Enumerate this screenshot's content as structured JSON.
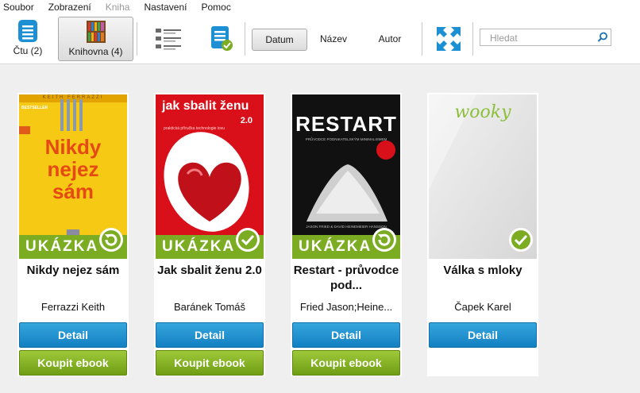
{
  "menu": [
    {
      "label": "Soubor",
      "enabled": true
    },
    {
      "label": "Zobrazení",
      "enabled": true
    },
    {
      "label": "Kniha",
      "enabled": false
    },
    {
      "label": "Nastavení",
      "enabled": true
    },
    {
      "label": "Pomoc",
      "enabled": true
    }
  ],
  "toolbar": {
    "reading_label": "Čtu  (2)",
    "library_label": "Knihovna (4)",
    "sort": {
      "date": "Datum",
      "title": "Název",
      "author": "Autor"
    },
    "search_placeholder": "Hledat"
  },
  "books": [
    {
      "title": "Nikdy nejez sám",
      "author": "Ferrazzi Keith",
      "detail": "Detail",
      "buy": "Koupit ebook",
      "cover": {
        "bg": "#f6c915",
        "top_text": "KEITH FERRAZZI",
        "badge": "BESTSELLER",
        "lines": [
          "Nikdy",
          "nejez",
          "sám"
        ],
        "ribbon": "UKÁZKA"
      },
      "status": "sample"
    },
    {
      "title": "Jak sbalit ženu 2.0",
      "author": "Baránek Tomáš",
      "detail": "Detail",
      "buy": "Koupit ebook",
      "cover": {
        "bg": "#d9101a",
        "lines": [
          "jak sbalit ženu",
          "2.0"
        ],
        "subtitle": "praktická příručka technologie lovu",
        "ribbon": "UKÁZKA"
      },
      "status": "done"
    },
    {
      "title": "Restart - průvodce pod...",
      "author": "Fried Jason;Heine...",
      "detail": "Detail",
      "buy": "Koupit ebook",
      "cover": {
        "bg": "#111111",
        "lines": [
          "RESTART"
        ],
        "subtitle": "PRŮVODCE PODNIKATELSKÝM MINIMALISMEM",
        "bottom": "JASON FRIED & DAVID HEINEMEIER HANSSON",
        "ribbon": "UKÁZKA"
      },
      "status": "sample"
    },
    {
      "title": "Válka s mloky",
      "author": "Čapek Karel",
      "detail": "Detail",
      "cover": {
        "bg": "#e3e3e3",
        "lines": [
          "wooky"
        ]
      },
      "status": "done"
    }
  ],
  "colors": {
    "accent_blue": "#1380c2",
    "accent_green": "#7bac22"
  }
}
